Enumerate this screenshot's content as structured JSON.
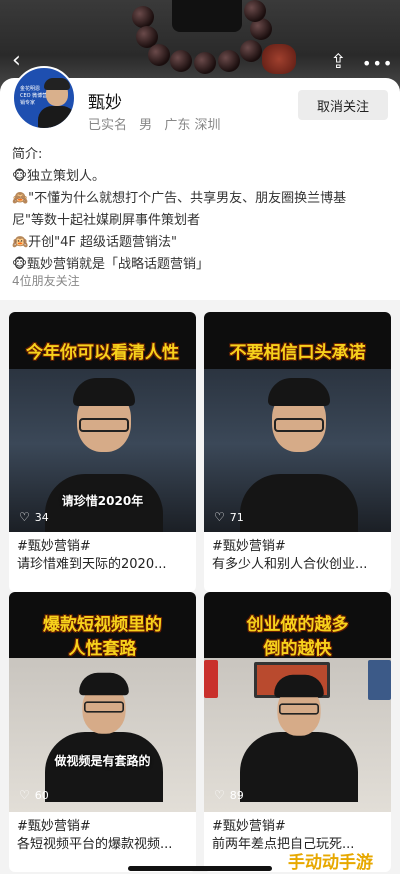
{
  "header": {
    "back_icon": "‹",
    "share_icon": "⇪",
    "more_icon": "•••"
  },
  "profile": {
    "name": "甄妙",
    "verified": "已实名",
    "gender": "男",
    "location": "广东 深圳",
    "unfollow_label": "取消关注",
    "bio_title": "简介:",
    "bio_lines": [
      "🐵独立策划人。",
      "🙈\"不懂为什么就想打个广告、共享男友、朋友圈换兰博基",
      "尼\"等数十起社媒刷屏事件策划者",
      "🙉开创\"4F 超级话题营销法\"",
      "🐵甄妙营销就是「战略话题营销」"
    ],
    "friends": "4位朋友关注",
    "avatar_text": "金花明恩CEO 微博营销专家"
  },
  "videos": [
    {
      "top_caption": "今年你可以看清人性",
      "bottom_caption": "请珍惜2020年",
      "likes": "34",
      "tag": "#甄妙营销#",
      "title": "请珍惜难到天际的2020..."
    },
    {
      "top_caption": "不要相信口头承诺",
      "bottom_caption": "",
      "likes": "71",
      "tag": "#甄妙营销#",
      "title": "有多少人和别人合伙创业..."
    },
    {
      "top_caption_1": "爆款短视频里的",
      "top_caption_2": "人性套路",
      "bottom_caption": "做视频是有套路的",
      "likes": "60",
      "tag": "#甄妙营销#",
      "title": "各短视频平台的爆款视频..."
    },
    {
      "top_caption_1": "创业做的越多",
      "top_caption_2": "倒的越快",
      "bottom_caption": "",
      "likes": "89",
      "tag": "#甄妙营销#",
      "title": "前两年差点把自己玩死..."
    }
  ],
  "watermark": "手动动手游",
  "colors": {
    "caption_yellow": "#f7d21c",
    "accent_bg": "#1e4fb0"
  }
}
